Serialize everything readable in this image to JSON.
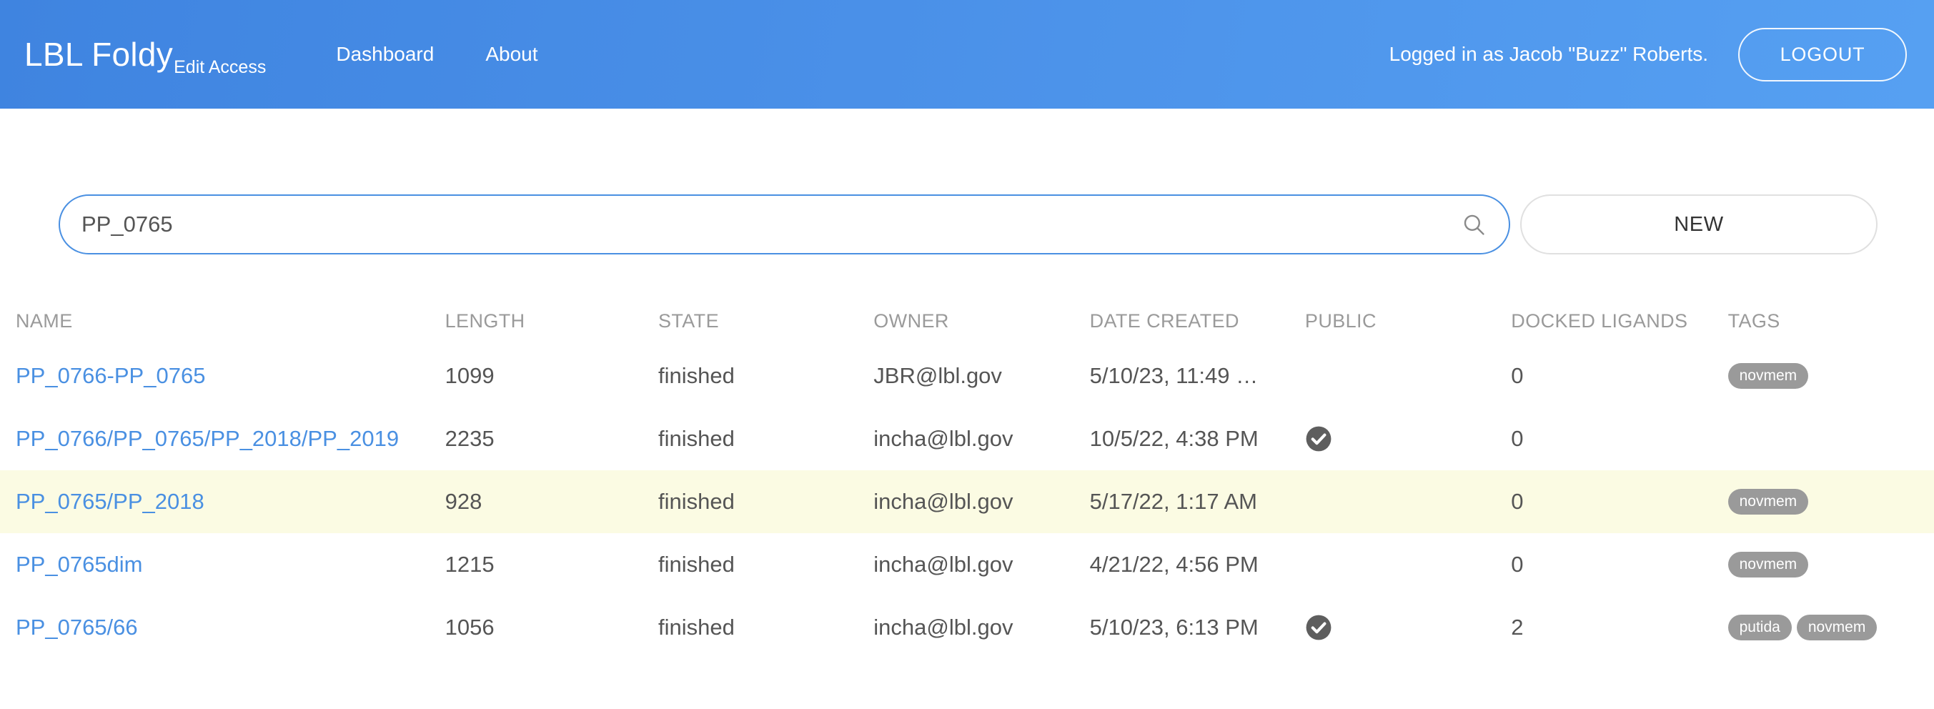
{
  "appbar": {
    "brand_title": "LBL Foldy",
    "brand_subtitle": "Edit Access",
    "nav": [
      {
        "label": "Dashboard"
      },
      {
        "label": "About"
      }
    ],
    "login_status": "Logged in as Jacob \"Buzz\" Roberts.",
    "logout_label": "LOGOUT",
    "background_color": "#4a90e8"
  },
  "toolbar": {
    "search_value": "PP_0765",
    "search_placeholder": "",
    "search_icon": "search-icon",
    "new_label": "NEW",
    "accent_color": "#4a90e2"
  },
  "table": {
    "columns": [
      "NAME",
      "LENGTH",
      "STATE",
      "OWNER",
      "DATE CREATED",
      "PUBLIC",
      "DOCKED LIGANDS",
      "TAGS"
    ],
    "rows": [
      {
        "name": "PP_0766-PP_0765",
        "length": "1099",
        "state": "finished",
        "owner": "JBR@lbl.gov",
        "date_created": "5/10/23, 11:49 …",
        "public": false,
        "docked_ligands": "0",
        "tags": [
          "novmem"
        ],
        "highlighted": false
      },
      {
        "name": "PP_0766/PP_0765/PP_2018/PP_2019",
        "length": "2235",
        "state": "finished",
        "owner": "incha@lbl.gov",
        "date_created": "10/5/22, 4:38 PM",
        "public": true,
        "docked_ligands": "0",
        "tags": [],
        "highlighted": false
      },
      {
        "name": "PP_0765/PP_2018",
        "length": "928",
        "state": "finished",
        "owner": "incha@lbl.gov",
        "date_created": "5/17/22, 1:17 AM",
        "public": false,
        "docked_ligands": "0",
        "tags": [
          "novmem"
        ],
        "highlighted": true
      },
      {
        "name": "PP_0765dim",
        "length": "1215",
        "state": "finished",
        "owner": "incha@lbl.gov",
        "date_created": "4/21/22, 4:56 PM",
        "public": false,
        "docked_ligands": "0",
        "tags": [
          "novmem"
        ],
        "highlighted": false
      },
      {
        "name": "PP_0765/66",
        "length": "1056",
        "state": "finished",
        "owner": "incha@lbl.gov",
        "date_created": "5/10/23, 6:13 PM",
        "public": true,
        "docked_ligands": "2",
        "tags": [
          "putida",
          "novmem"
        ],
        "highlighted": false
      }
    ],
    "public_true_icon": "check-circle-icon",
    "tag_color": "#9a9a9a",
    "link_color": "#4a90e2",
    "highlight_color": "#fbfbe3"
  }
}
